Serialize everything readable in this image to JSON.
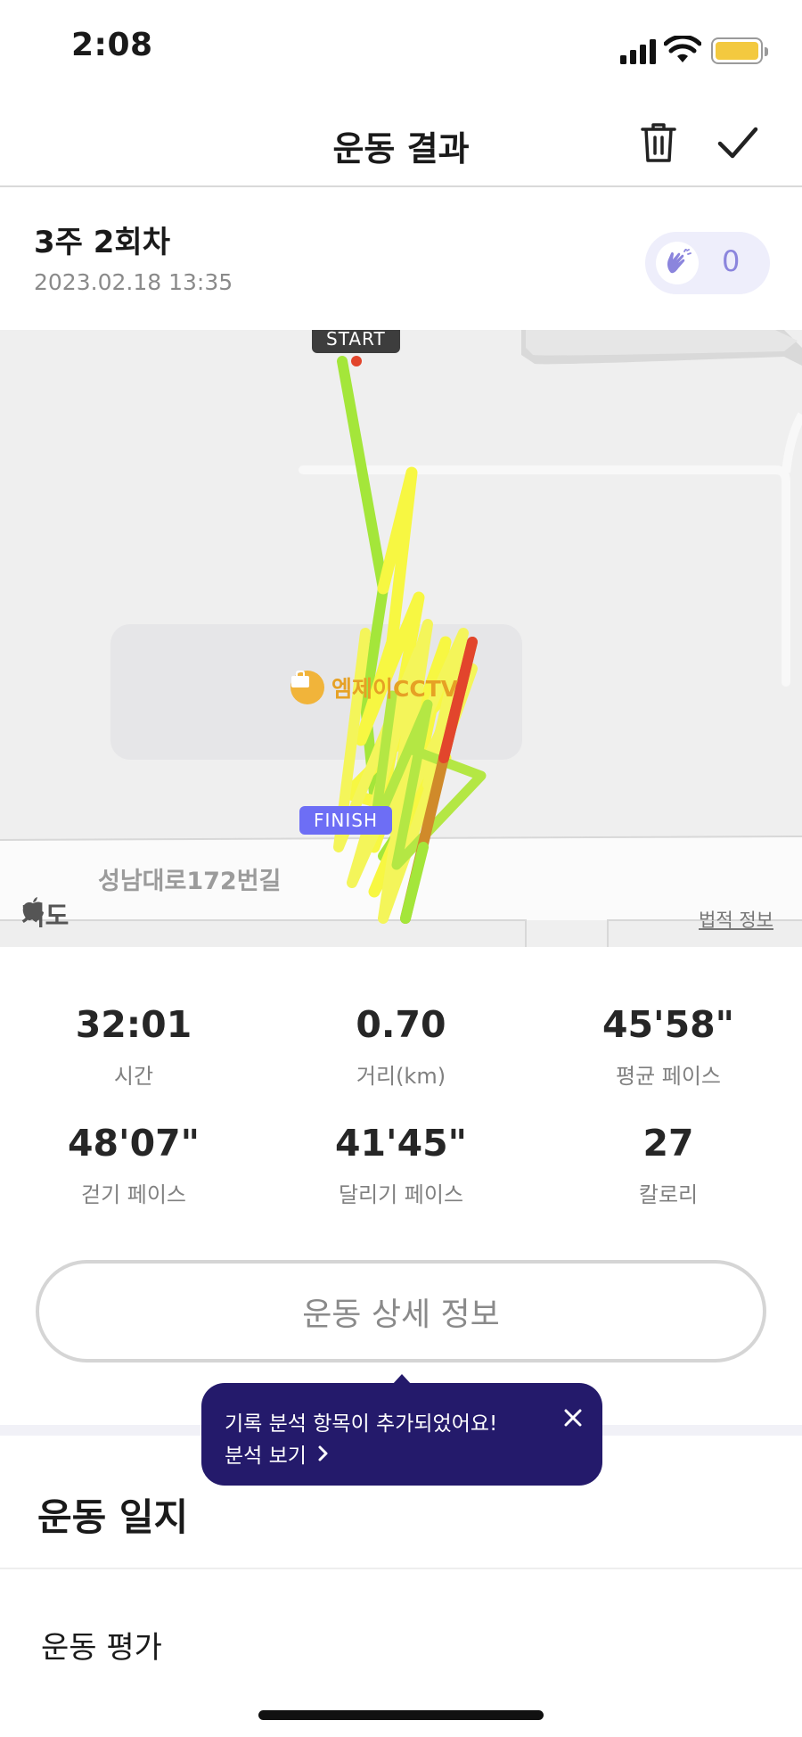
{
  "status_bar": {
    "time": "2:08"
  },
  "header": {
    "title": "운동 결과"
  },
  "workout": {
    "name": "3주 2회차",
    "datetime": "2023.02.18 13:35",
    "clap_count": "0"
  },
  "map": {
    "start_label": "START",
    "finish_label": "FINISH",
    "poi_name": "엠제이CCTV",
    "road_name": "성남대로172번길",
    "brand_text": "지도",
    "legal_link": "법적 정보"
  },
  "stats": [
    {
      "value": "32:01",
      "label": "시간"
    },
    {
      "value": "0.70",
      "label": "거리(km)"
    },
    {
      "value": "45'58\"",
      "label": "평균 페이스"
    },
    {
      "value": "48'07\"",
      "label": "걷기 페이스"
    },
    {
      "value": "41'45\"",
      "label": "달리기 페이스"
    },
    {
      "value": "27",
      "label": "칼로리"
    }
  ],
  "detail_button": "운동 상세 정보",
  "tooltip": {
    "message": "기록 분석 항목이 추가되었어요!",
    "link": "분석 보기"
  },
  "journal": {
    "title": "운동 일지",
    "evaluation_title": "운동 평가"
  },
  "colors": {
    "accent": "#6d6ef5",
    "tooltip_bg": "#241a6b",
    "battery": "#f3c93f",
    "route_slow": "#f7f742",
    "route_mid": "#a4e63a",
    "route_fast": "#e2452c"
  }
}
